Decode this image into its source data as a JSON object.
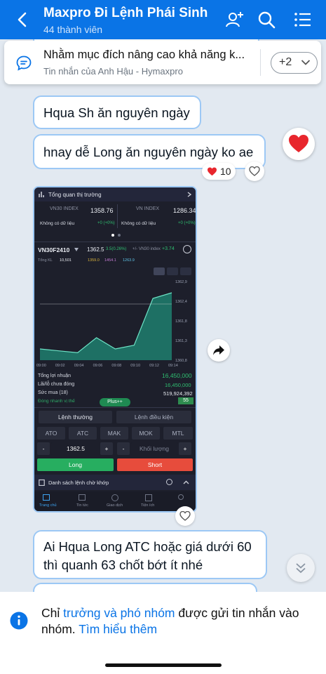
{
  "header": {
    "title": "Maxpro Đi Lệnh Phái Sinh",
    "subtitle": "44 thành viên"
  },
  "pinned": {
    "text": "Nhằm mục đích nâng cao khả năng k...",
    "sender": "Tin nhắn của Anh Hậu - Hymaxpro",
    "more_label": "+2"
  },
  "messages": {
    "m1": "Hqua Sh ăn nguyên ngày",
    "m2": "hnay dễ Long ăn nguyên ngày ko ae",
    "m2_reaction_count": "10",
    "m3_line1": "Ai Hqua Long ATC hoặc giá dưới 60",
    "m3_line2": "thì quanh 63 chốt bớt ít nhé"
  },
  "trading": {
    "market_overview": "Tổng quan thị trường",
    "vn30_label": "VN30 INDEX",
    "vn30_value": "1358.76",
    "vn_label": "VN INDEX",
    "vn_value": "1286.34",
    "no_data": "Không có dữ liệu",
    "change_zero": "+0 (+0%)",
    "symbol": "VN30F2410",
    "price": "1362.5",
    "price_change": "3.5(0.26%)",
    "basis_label": "+/- VN30 index",
    "basis_value": "+3.74",
    "volume_label": "Tổng KL",
    "volume": "10,501",
    "ref1": "1359.0",
    "ref2": "1454.1",
    "ref3": "1263.9",
    "y_ticks": [
      "1362,9",
      "1362,4",
      "1361,8",
      "1361,3",
      "1360,8"
    ],
    "x_ticks": [
      "09:00",
      "09:02",
      "09:04",
      "09:06",
      "09:08",
      "09:10",
      "09:12",
      "09:14"
    ],
    "total_profit_label": "Tổng lợi nhuận",
    "total_profit": "16,450,000",
    "unrealized_label": "Lãi/lỗ chưa đóng",
    "unrealized": "16,450,000",
    "buying_power_label": "Sức mua (18)",
    "buying_power": "519,924,392",
    "close_all_label": "Đóng nhanh vị thế",
    "close_all_value": "55",
    "plus_label": "Plus++",
    "order_normal": "Lệnh thường",
    "order_condition": "Lệnh điều kiện",
    "order_types": [
      "ATO",
      "ATC",
      "MAK",
      "MOK",
      "MTL"
    ],
    "order_price": "1362.5",
    "qty_placeholder": "Khối lượng",
    "long_label": "Long",
    "short_label": "Short",
    "pending_label": "Danh sách lệnh chờ khớp",
    "nav_home": "Trang chủ",
    "nav_news": "Tin tức",
    "nav_trade": "Giao dịch",
    "nav_util": "Tiện ích",
    "chart_colors": {
      "line": "#6de3c6",
      "fill": "#1f7f6e",
      "ref": "#e6e6e6"
    }
  },
  "chart_data": {
    "type": "area",
    "x": [
      "09:00",
      "09:02",
      "09:04",
      "09:06",
      "09:08",
      "09:10",
      "09:12",
      "09:14"
    ],
    "ylim": [
      1360.8,
      1362.9
    ],
    "series": [
      {
        "values": [
          1361.1,
          1361.05,
          1361.0,
          1361.4,
          1361.1,
          1361.2,
          1362.45,
          1362.6
        ]
      }
    ]
  },
  "footer": {
    "notice_prefix": "Chỉ ",
    "notice_link1": "trưởng và phó nhóm",
    "notice_mid": " được gửi tin nhắn vào nhóm. ",
    "notice_link2": "Tìm hiểu thêm"
  },
  "colors": {
    "header_bg": "#0a74e6",
    "chat_bg": "#e2e9f1",
    "bubble_border": "#9cc8f5",
    "long_green": "#27ae60",
    "short_red": "#e74c3c"
  }
}
